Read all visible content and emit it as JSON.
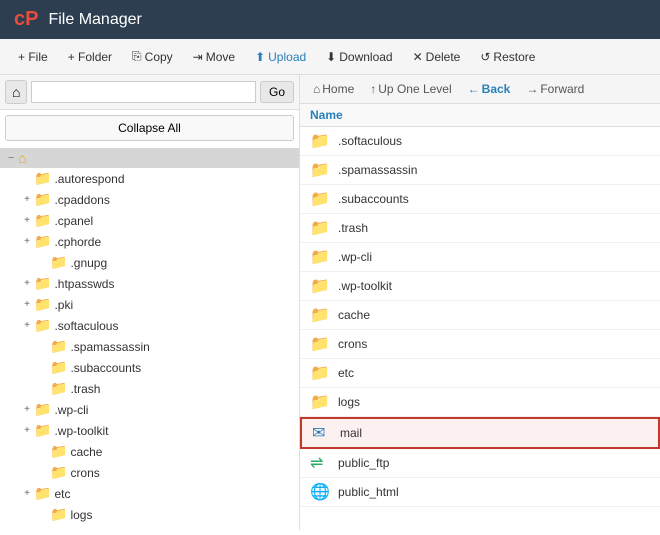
{
  "header": {
    "logo": "cP",
    "title": "File Manager"
  },
  "toolbar": {
    "items": [
      {
        "id": "file",
        "label": "+ File",
        "icon": ""
      },
      {
        "id": "folder",
        "label": "+ Folder",
        "icon": ""
      },
      {
        "id": "copy",
        "label": "Copy",
        "icon": "⎘"
      },
      {
        "id": "move",
        "label": "Move",
        "icon": "⇥"
      },
      {
        "id": "upload",
        "label": "Upload",
        "icon": "⬆"
      },
      {
        "id": "download",
        "label": "Download",
        "icon": "⬇"
      },
      {
        "id": "delete",
        "label": "Delete",
        "icon": "✕"
      },
      {
        "id": "restore",
        "label": "Restore",
        "icon": "↺"
      }
    ]
  },
  "left_panel": {
    "path_input": "",
    "go_label": "Go",
    "collapse_all_label": "Collapse All",
    "tree": [
      {
        "id": "root",
        "label": "⌂",
        "indent": 0,
        "toggle": "−",
        "is_root": true
      },
      {
        "id": "autorespond",
        "label": ".autorespond",
        "indent": 1,
        "toggle": ""
      },
      {
        "id": "cpaddons",
        "label": ".cpaddons",
        "indent": 1,
        "toggle": "+"
      },
      {
        "id": "cpanel",
        "label": ".cpanel",
        "indent": 1,
        "toggle": "+"
      },
      {
        "id": "cphorde",
        "label": ".cphorde",
        "indent": 1,
        "toggle": "+"
      },
      {
        "id": "gnupg",
        "label": ".gnupg",
        "indent": 2,
        "toggle": ""
      },
      {
        "id": "htpasswds",
        "label": ".htpasswds",
        "indent": 1,
        "toggle": "+"
      },
      {
        "id": "pki",
        "label": ".pki",
        "indent": 1,
        "toggle": "+"
      },
      {
        "id": "softaculous",
        "label": ".softaculous",
        "indent": 1,
        "toggle": "+"
      },
      {
        "id": "spamassassin",
        "label": ".spamassassin",
        "indent": 2,
        "toggle": ""
      },
      {
        "id": "subaccounts",
        "label": ".subaccounts",
        "indent": 2,
        "toggle": ""
      },
      {
        "id": "trash",
        "label": ".trash",
        "indent": 2,
        "toggle": ""
      },
      {
        "id": "wp-cli",
        "label": ".wp-cli",
        "indent": 1,
        "toggle": "+"
      },
      {
        "id": "wp-toolkit",
        "label": ".wp-toolkit",
        "indent": 1,
        "toggle": "+"
      },
      {
        "id": "cache",
        "label": "cache",
        "indent": 2,
        "toggle": ""
      },
      {
        "id": "crons",
        "label": "crons",
        "indent": 2,
        "toggle": ""
      },
      {
        "id": "etc",
        "label": "etc",
        "indent": 1,
        "toggle": "+"
      },
      {
        "id": "logs",
        "label": "logs",
        "indent": 2,
        "toggle": ""
      }
    ]
  },
  "right_panel": {
    "nav": {
      "home": "Home",
      "up_one_level": "Up One Level",
      "back": "Back",
      "forward": "Forward"
    },
    "column_name": "Name",
    "files": [
      {
        "id": "softaculous",
        "name": ".softaculous",
        "type": "folder",
        "highlighted": false
      },
      {
        "id": "spamassassin",
        "name": ".spamassassin",
        "type": "folder",
        "highlighted": false
      },
      {
        "id": "subaccounts",
        "name": ".subaccounts",
        "type": "folder",
        "highlighted": false
      },
      {
        "id": "trash",
        "name": ".trash",
        "type": "folder",
        "highlighted": false
      },
      {
        "id": "wp-cli",
        "name": ".wp-cli",
        "type": "folder",
        "highlighted": false
      },
      {
        "id": "wp-toolkit",
        "name": ".wp-toolkit",
        "type": "folder",
        "highlighted": false
      },
      {
        "id": "cache",
        "name": "cache",
        "type": "folder",
        "highlighted": false
      },
      {
        "id": "crons",
        "name": "crons",
        "type": "folder",
        "highlighted": false
      },
      {
        "id": "etc",
        "name": "etc",
        "type": "folder",
        "highlighted": false
      },
      {
        "id": "logs",
        "name": "logs",
        "type": "folder",
        "highlighted": false
      },
      {
        "id": "mail",
        "name": "mail",
        "type": "mail",
        "highlighted": true
      },
      {
        "id": "public_ftp",
        "name": "public_ftp",
        "type": "ftp",
        "highlighted": false
      },
      {
        "id": "public_html",
        "name": "public_html",
        "type": "html",
        "highlighted": false
      }
    ]
  }
}
